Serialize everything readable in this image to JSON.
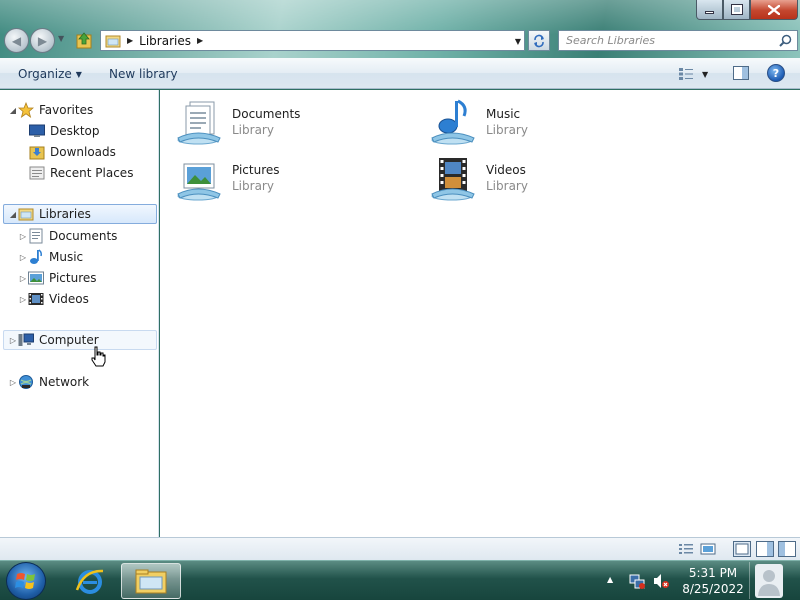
{
  "address": {
    "crumb": "Libraries"
  },
  "search": {
    "placeholder": "Search Libraries"
  },
  "toolbar": {
    "organize_label": "Organize",
    "new_library_label": "New library",
    "help_label": "?"
  },
  "navpane": {
    "favorites": {
      "label": "Favorites",
      "items": [
        {
          "label": "Desktop",
          "icon": "desktop-icon"
        },
        {
          "label": "Downloads",
          "icon": "downloads-folder-icon"
        },
        {
          "label": "Recent Places",
          "icon": "recent-places-icon"
        }
      ]
    },
    "libraries": {
      "label": "Libraries",
      "items": [
        {
          "label": "Documents",
          "icon": "documents-icon"
        },
        {
          "label": "Music",
          "icon": "music-icon"
        },
        {
          "label": "Pictures",
          "icon": "pictures-icon"
        },
        {
          "label": "Videos",
          "icon": "videos-icon"
        }
      ]
    },
    "computer": {
      "label": "Computer"
    },
    "network": {
      "label": "Network"
    }
  },
  "content": {
    "libraries": [
      {
        "name": "Documents",
        "type": "Library",
        "icon": "documents-library-icon"
      },
      {
        "name": "Music",
        "type": "Library",
        "icon": "music-library-icon"
      },
      {
        "name": "Pictures",
        "type": "Library",
        "icon": "pictures-library-icon"
      },
      {
        "name": "Videos",
        "type": "Library",
        "icon": "videos-library-icon"
      }
    ]
  },
  "taskbar": {
    "clock_time": "5:31 PM",
    "clock_date": "8/25/2022"
  },
  "colors": {
    "accent": "#1e395b",
    "selection_border": "#84acdd",
    "taskbar": "#21524a"
  }
}
